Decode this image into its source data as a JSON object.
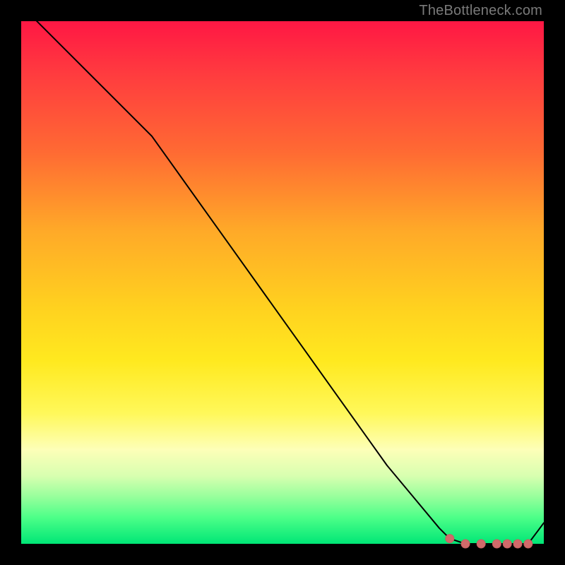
{
  "watermark": "TheBottleneck.com",
  "colors": {
    "line": "#000000",
    "marker_fill": "#d06a6a",
    "marker_stroke": "#c45f5f",
    "background_black": "#000000"
  },
  "chart_data": {
    "type": "line",
    "title": "",
    "xlabel": "",
    "ylabel": "",
    "xlim": [
      0,
      100
    ],
    "ylim": [
      0,
      100
    ],
    "grid": false,
    "legend": false,
    "series": [
      {
        "name": "main-curve",
        "x": [
          0,
          5,
          10,
          15,
          20,
          25,
          30,
          35,
          40,
          45,
          50,
          55,
          60,
          65,
          70,
          75,
          80,
          82,
          85,
          88,
          91,
          94,
          97,
          100
        ],
        "values": [
          103,
          98,
          93,
          88,
          83,
          78,
          71,
          64,
          57,
          50,
          43,
          36,
          29,
          22,
          15,
          9,
          3,
          1,
          0,
          0,
          0,
          0,
          0,
          4
        ]
      }
    ],
    "markers": {
      "name": "highlight-points",
      "x": [
        82,
        85,
        88,
        91,
        93,
        95,
        97
      ],
      "values": [
        1,
        0,
        0,
        0,
        0,
        0,
        0
      ]
    }
  }
}
